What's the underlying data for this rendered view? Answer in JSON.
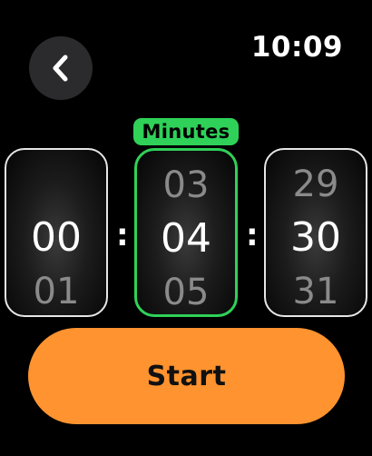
{
  "status_bar": {
    "time": "10:09"
  },
  "picker": {
    "active_field_label": "Minutes",
    "separator": ":",
    "wheels": {
      "hours": {
        "prev": "",
        "current": "00",
        "next": "01"
      },
      "minutes": {
        "prev": "03",
        "current": "04",
        "next": "05"
      },
      "seconds": {
        "prev": "29",
        "current": "30",
        "next": "31"
      }
    }
  },
  "actions": {
    "start_label": "Start"
  },
  "colors": {
    "background": "#000000",
    "accent_green": "#2fd158",
    "start_orange": "#ff932f",
    "back_button_bg": "#2b2b2d"
  },
  "icons": {
    "back": "chevron-left-icon"
  }
}
